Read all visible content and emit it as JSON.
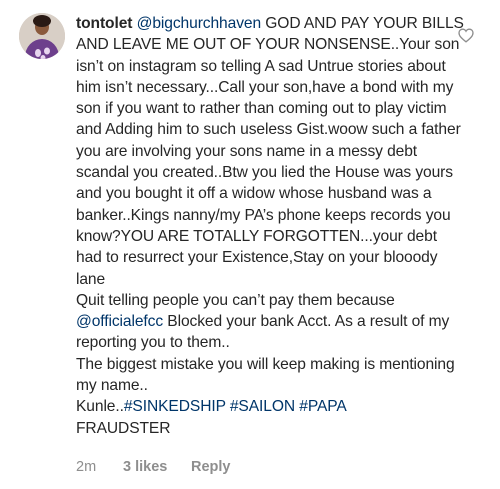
{
  "comment": {
    "username": "tontolet",
    "mention_1": "@bigchurchhaven",
    "text_1": " GOD AND PAY YOUR BILLS AND LEAVE ME OUT OF YOUR NONSENSE..Your son isn’t on instagram so telling A sad Untrue stories about him isn’t necessary...Call your son,have a bond with my son if you want to rather than coming out to play victim and Adding him to such useless Gist.woow such a father you are involving your sons name in a messy debt scandal you created..Btw you lied the House was yours and you bought it off a widow whose husband was a banker..Kings nanny/my PA’s phone keeps records you know?YOU ARE TOTALLY FORGOTTEN...your debt had to resurrect your Existence,Stay on your blooody lane\nQuit telling people you can’t pay them because ",
    "mention_2": "@officialefcc",
    "text_2": " Blocked your bank Acct. As a result of my reporting you to them..\nThe biggest mistake you will keep making is mentioning my name..\nKunle..",
    "hashtag_1": "#SINKEDSHIP",
    "hashtag_2": "#SAILON",
    "hashtag_3": "#PAPA",
    "text_3": "\nFRAUDSTER",
    "time": "2m",
    "likes": "3 likes",
    "reply": "Reply"
  },
  "icons": {
    "like": "heart-outline-icon",
    "avatar": "profile-avatar"
  },
  "colors": {
    "text": "#262626",
    "link": "#003569",
    "meta": "#8e8e8e"
  }
}
